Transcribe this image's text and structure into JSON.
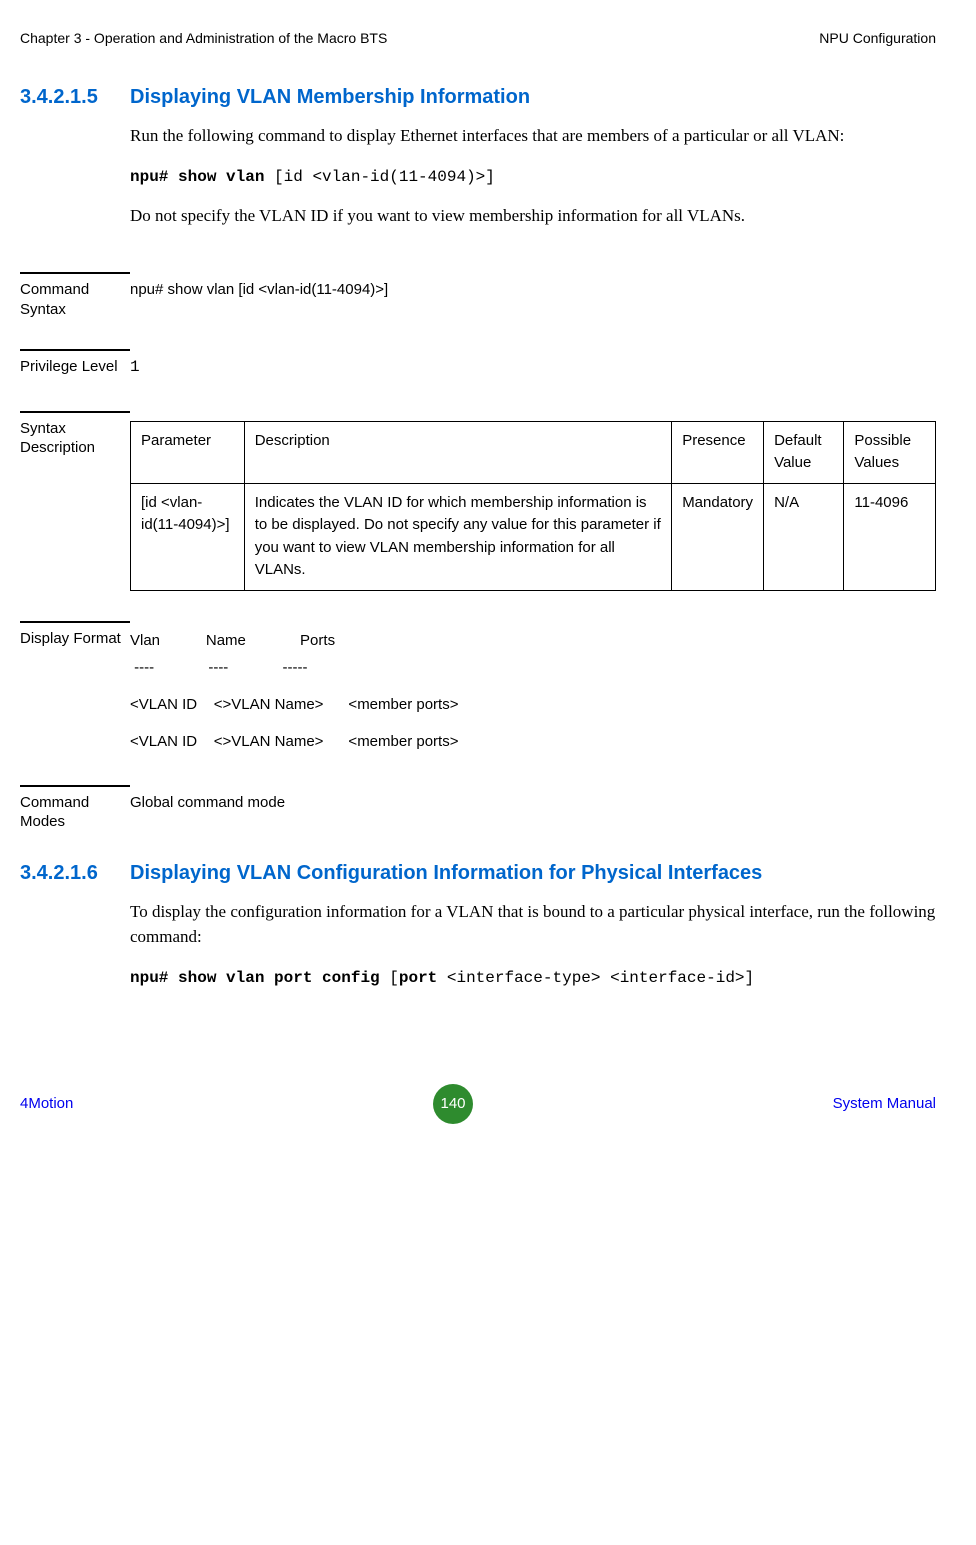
{
  "header": {
    "left": "Chapter 3 - Operation and Administration of the Macro BTS",
    "right": "NPU Configuration"
  },
  "section1": {
    "num": "3.4.2.1.5",
    "title": "Displaying VLAN Membership Information",
    "para1": "Run the following command to display Ethernet interfaces that are members of a particular or all VLAN:",
    "cmd_bold": "npu# show vlan ",
    "cmd_rest": "[id <vlan-id(11-4094)>]",
    "para2": "Do not specify the VLAN ID if you want to view membership information for all VLANs."
  },
  "meta": {
    "command_syntax_label": "Command Syntax",
    "command_syntax_value": "npu# show vlan [id <vlan-id(11-4094)>]",
    "privilege_label": "Privilege Level",
    "privilege_value": "1",
    "syntax_desc_label": "Syntax Description",
    "table": {
      "h1": "Parameter",
      "h2": "Description",
      "h3": "Presence",
      "h4": "Default Value",
      "h5": "Possible Values",
      "r1c1": "[id <vlan-id(11-4094)>]",
      "r1c2": "Indicates the VLAN ID for which membership information is to be displayed. Do not specify any value for this parameter if you want to view VLAN membership information for all VLANs.",
      "r1c3": "Mandatory",
      "r1c4": "N/A",
      "r1c5": "11-4096"
    },
    "display_label": "Display Format",
    "display_line1": "Vlan           Name             Ports",
    "display_line2": " ----             ----             -----",
    "display_line3": "<VLAN ID    <>VLAN Name>      <member ports>",
    "display_line4": "<VLAN ID    <>VLAN Name>      <member ports>",
    "modes_label": "Command Modes",
    "modes_value": "Global command mode"
  },
  "section2": {
    "num": "3.4.2.1.6",
    "title": "Displaying VLAN Configuration Information for Physical Interfaces",
    "para1": "To display the configuration information for a VLAN that is bound to a particular physical interface, run the following command:",
    "cmd_bold1": "npu# show vlan port config ",
    "cmd_mid1": "[",
    "cmd_bold2": "port",
    "cmd_rest": " <interface-type> <interface-id>]"
  },
  "footer": {
    "left": "4Motion",
    "page": "140",
    "right": "System Manual"
  }
}
